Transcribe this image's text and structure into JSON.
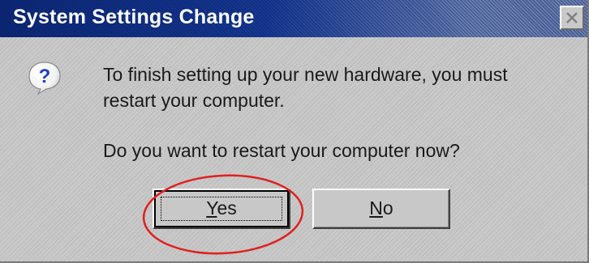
{
  "window": {
    "title": "System Settings Change",
    "close_icon": "close-icon"
  },
  "message": {
    "icon": "question-icon",
    "line1": "To finish setting up your new hardware, you must",
    "line2": "restart your computer.",
    "line3": "Do you want to restart your computer now?"
  },
  "buttons": {
    "yes": {
      "mnemonic": "Y",
      "rest": "es",
      "focused": true
    },
    "no": {
      "mnemonic": "N",
      "rest": "o"
    }
  },
  "annotation": {
    "shape": "ellipse",
    "color": "#e02020",
    "target": "yes-button"
  },
  "colors": {
    "titlebar": "#0a2470",
    "dialog_background": "#c6c6c6",
    "icon_blue": "#1c3fc4"
  }
}
